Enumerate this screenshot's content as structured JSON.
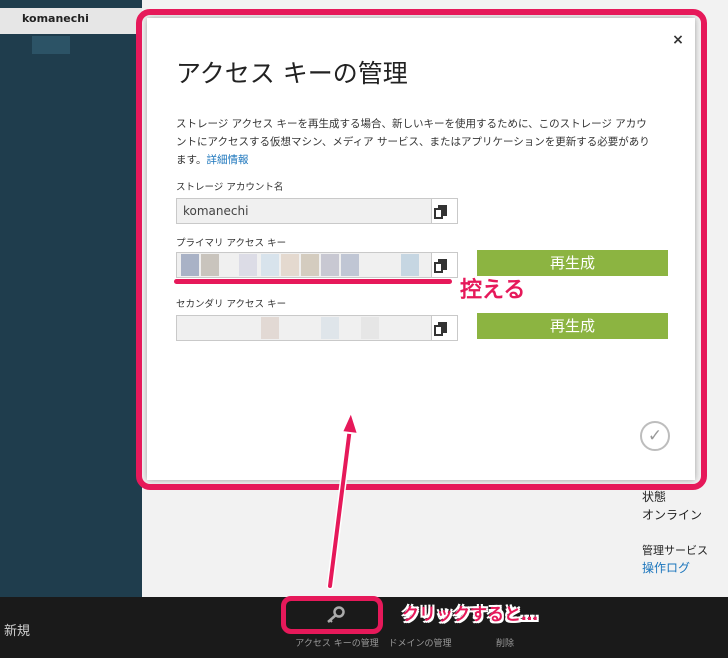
{
  "sidebar": {
    "item_label": "komanechi"
  },
  "background": {
    "status_label": "状態",
    "status_value": "オンライン",
    "managed_services_label": "管理サービス",
    "operation_log_link": "操作ログ"
  },
  "cmdbar": {
    "new_label": "新規",
    "access_key_label": "アクセス キーの管理",
    "domain_label": "ドメインの管理",
    "delete_label": "削除"
  },
  "dialog": {
    "close_glyph": "×",
    "title": "アクセス キーの管理",
    "description": "ストレージ アクセス キーを再生成する場合、新しいキーを使用するために、このストレージ アカウントにアクセスする仮想マシン、メディア サービス、またはアプリケーションを更新する必要があります。",
    "details_link": "詳細情報",
    "account_name_label": "ストレージ アカウント名",
    "account_name_value": "komanechi",
    "primary_key_label": "プライマリ アクセス キー",
    "secondary_key_label": "セカンダリ アクセス キー",
    "regenerate_label": "再生成",
    "ok_glyph": "✓"
  },
  "annotations": {
    "copy_note": "控える",
    "click_note": "クリックすると…"
  },
  "colors": {
    "accent_pink": "#e6195a",
    "regen_green": "#8cb441",
    "link_blue": "#1b75bc"
  },
  "icons": [
    "close-icon",
    "copy-icon",
    "key-icon",
    "checkmark-icon"
  ]
}
